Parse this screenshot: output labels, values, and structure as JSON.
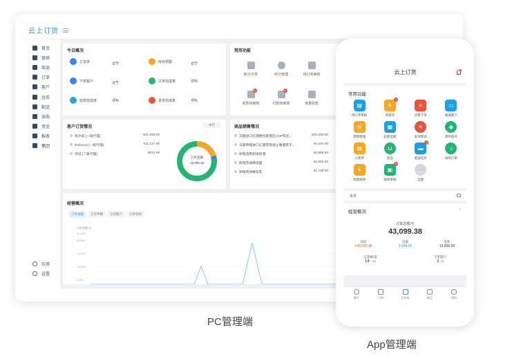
{
  "pc": {
    "logo": "云上订货",
    "sidebar": [
      "首页",
      "营销",
      "商品",
      "订单",
      "客户",
      "仓库",
      "配送",
      "采购",
      "资金",
      "报表",
      "集团"
    ],
    "sidebar_bottom": [
      "应用",
      "设置"
    ],
    "overview": {
      "title": "今日概况",
      "stats": [
        {
          "label": "订货单",
          "value": "0个",
          "color": "#3b82f6"
        },
        {
          "label": "库存预警",
          "value": "0个",
          "color": "#f5a623"
        },
        {
          "label": "下单客户",
          "value": "0个",
          "color": "#3b82f6"
        },
        {
          "label": "订单完成率",
          "value": "0%",
          "color": "#22b573"
        },
        {
          "label": "收款完成率",
          "value": "0%",
          "color": "#1ea7e1"
        },
        {
          "label": "发货完成率",
          "value": "0%",
          "color": "#e8553d"
        }
      ]
    },
    "functions": {
      "title": "常用功能",
      "items": [
        {
          "label": "新分订单",
          "badge": ""
        },
        {
          "label": "商分管理",
          "badge": ""
        },
        {
          "label": "待订单审核",
          "badge": ""
        },
        {
          "label": "收款待审核",
          "badge": "6"
        },
        {
          "label": "付款待审核",
          "badge": "6"
        },
        {
          "label": "批量收款",
          "badge": ""
        }
      ]
    },
    "customer_orders": {
      "title": "客户订货情况",
      "filter": "本月",
      "rows": [
        {
          "name": "张冷皮 [一级代理]",
          "amount": "¥31,048.00"
        },
        {
          "name": "limliao12 [一级代理]",
          "amount": "¥11,137.80"
        },
        {
          "name": "测试 [二级代理]",
          "amount": "¥913.58"
        }
      ],
      "donut_label": "订单金额",
      "donut_value": "43,099.38"
    },
    "sales": {
      "title": "商品销售情况",
      "rows": [
        {
          "name": "法国进口红酒格拉斯酒庄AOP梵庄...",
          "amount": "¥25,200.00"
        },
        {
          "name": "法国原瓶进口红酒梵蔻骑士雅酒梵干...",
          "amount": "¥4,200.00"
        },
        {
          "name": "玫瑰泡用研发新酒",
          "amount": "¥2,898.00"
        },
        {
          "name": "玫瑰普通精华面",
          "amount": "¥2,068.00"
        },
        {
          "name": "玫瑰草饼精华乳",
          "amount": "¥1,738.00"
        }
      ]
    },
    "business": {
      "title": "经营概况",
      "tabs": [
        "订单金额",
        "订货单数",
        "订货客户",
        "订单毛利"
      ],
      "ylabel": "订单金额/元",
      "yticks": [
        "23,200",
        "20,000",
        "15,000",
        "10,000",
        "5,000"
      ]
    },
    "caption": "PC管理端"
  },
  "app": {
    "title": "云上订货",
    "functions_title": "常用功能",
    "apps": [
      {
        "label": "待订单审核",
        "color": "#1e9ee3",
        "badge": ""
      },
      {
        "label": "待发货",
        "color": "#f5a623",
        "badge": "1"
      },
      {
        "label": "代客下单",
        "color": "#e8553d",
        "badge": ""
      },
      {
        "label": "邀请客户",
        "color": "#1e9ee3",
        "badge": ""
      },
      {
        "label": "营销管理",
        "color": "#f5a623",
        "badge": ""
      },
      {
        "label": "扣款出库",
        "color": "#1e9ee3",
        "badge": ""
      },
      {
        "label": "发货物流",
        "color": "#e8553d",
        "badge": ""
      },
      {
        "label": "库存盘点",
        "color": "#22b573",
        "badge": ""
      },
      {
        "label": "入库单",
        "color": "#f5a623",
        "badge": ""
      },
      {
        "label": "商品",
        "color": "#22b573",
        "badge": ""
      },
      {
        "label": "配送任务",
        "color": "#1e9ee3",
        "badge": "1"
      },
      {
        "label": "采购订单",
        "color": "#22b573",
        "badge": ""
      },
      {
        "label": "批量收款",
        "color": "#f5a623",
        "badge": ""
      },
      {
        "label": "收款审核",
        "color": "#22b573",
        "badge": "3"
      },
      {
        "label": "全部",
        "color": "#d5d8dd",
        "badge": ""
      }
    ],
    "period": "本月",
    "business_title": "经营概况",
    "total_label": "订单总额/元",
    "total_value": "43,099.38",
    "compare": [
      {
        "label": "同比",
        "value": "+43,099.38",
        "color": "#e8553d"
      },
      {
        "label": "已收",
        "value": "3,049.00",
        "color": "#1e9ee3"
      },
      {
        "label": "毛利",
        "value": "19,836.58",
        "color": "#333333"
      }
    ],
    "orders_label": "订单数/笔",
    "orders_value": "14",
    "orders_delta": "+14",
    "customers_label": "下单客户",
    "customers_value": "3",
    "customers_delta": "+3",
    "nav": [
      "客户",
      "订单",
      "工作台",
      "商品",
      "我的"
    ],
    "caption": "App管理端"
  }
}
